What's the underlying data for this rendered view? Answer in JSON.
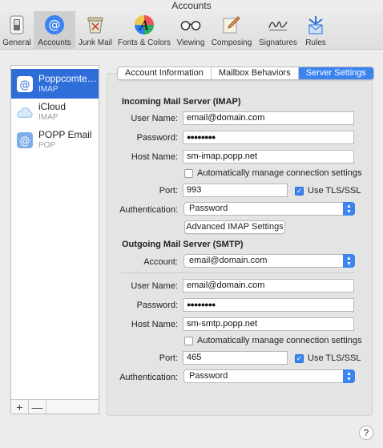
{
  "window": {
    "title": "Accounts"
  },
  "toolbar": {
    "items": [
      {
        "label": "General",
        "icon": "general-switch-icon"
      },
      {
        "label": "Accounts",
        "icon": "at-sign-icon"
      },
      {
        "label": "Junk Mail",
        "icon": "junk-mail-icon"
      },
      {
        "label": "Fonts & Colors",
        "icon": "fonts-colors-icon"
      },
      {
        "label": "Viewing",
        "icon": "glasses-icon"
      },
      {
        "label": "Composing",
        "icon": "pencil-icon"
      },
      {
        "label": "Signatures",
        "icon": "signature-icon"
      },
      {
        "label": "Rules",
        "icon": "rules-icon"
      }
    ],
    "active": "Accounts"
  },
  "sidebar": {
    "accounts": [
      {
        "name": "Poppcomte…",
        "type": "IMAP",
        "icon": "at-sign-icon",
        "selected": true
      },
      {
        "name": "iCloud",
        "type": "IMAP",
        "icon": "cloud-icon",
        "selected": false
      },
      {
        "name": "POPP Email",
        "type": "POP",
        "icon": "at-sign-icon",
        "selected": false
      }
    ],
    "add_label": "+",
    "remove_label": "—"
  },
  "tabs": [
    {
      "label": "Account Information",
      "active": false
    },
    {
      "label": "Mailbox Behaviors",
      "active": false
    },
    {
      "label": "Server Settings",
      "active": true
    }
  ],
  "incoming": {
    "title": "Incoming Mail Server (IMAP)",
    "username_label": "User Name:",
    "username": "email@domain.com",
    "password_label": "Password:",
    "password": "●●●●●●●●",
    "hostname_label": "Host Name:",
    "hostname": "sm-imap.popp.net",
    "auto_manage_label": "Automatically manage connection settings",
    "auto_manage": false,
    "port_label": "Port:",
    "port": "993",
    "tls_label": "Use TLS/SSL",
    "tls": true,
    "auth_label": "Authentication:",
    "auth": "Password",
    "advanced_button": "Advanced IMAP Settings"
  },
  "outgoing": {
    "title": "Outgoing Mail Server (SMTP)",
    "account_label": "Account:",
    "account": "email@domain.com",
    "username_label": "User Name:",
    "username": "email@domain.com",
    "password_label": "Password:",
    "password": "●●●●●●●●",
    "hostname_label": "Host Name:",
    "hostname": "sm-smtp.popp.net",
    "auto_manage_label": "Automatically manage connection settings",
    "auto_manage": false,
    "port_label": "Port:",
    "port": "465",
    "tls_label": "Use TLS/SSL",
    "tls": true,
    "auth_label": "Authentication:",
    "auth": "Password"
  },
  "help_label": "?",
  "colors": {
    "accent": "#3b84ef",
    "selection": "#2f6ed9"
  }
}
